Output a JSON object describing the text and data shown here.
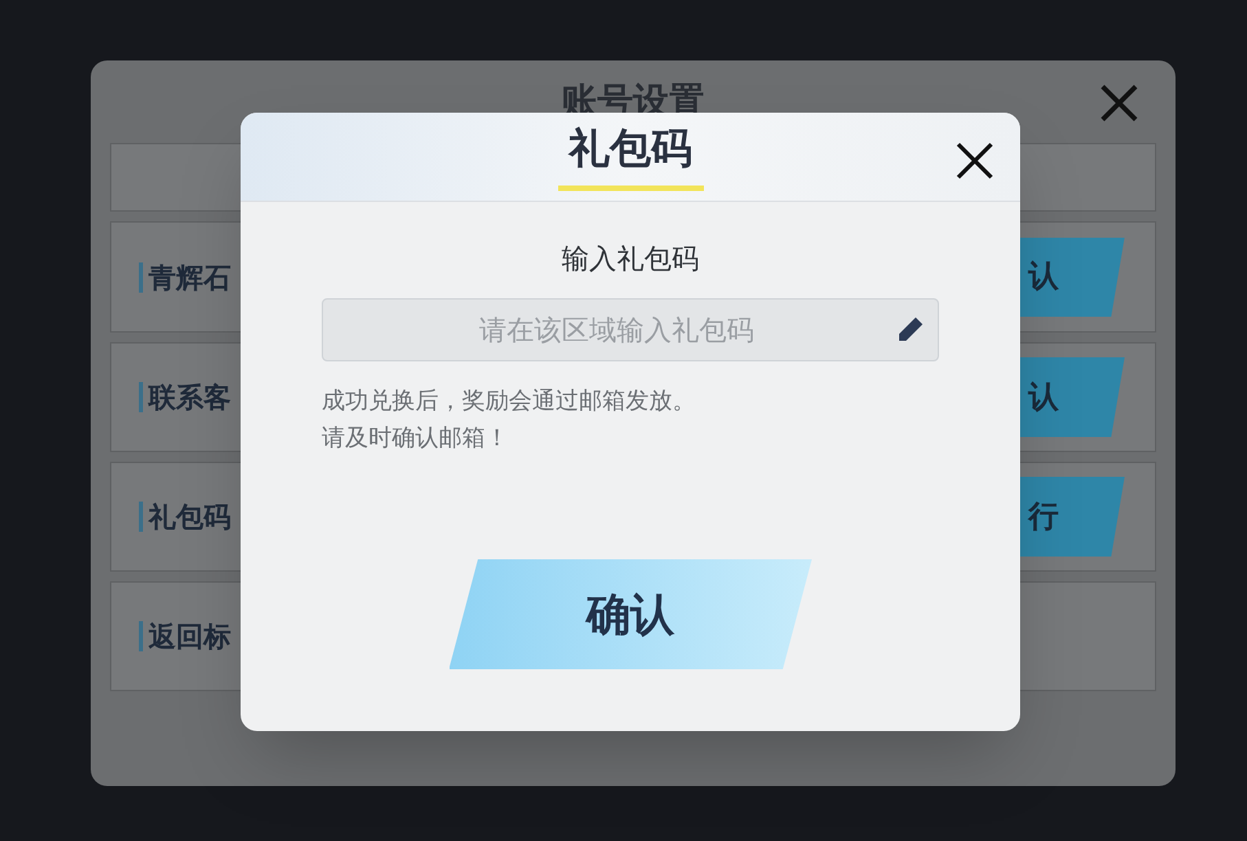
{
  "back_dialog": {
    "title": "账号设置",
    "rows": [
      {
        "label": "",
        "button": ""
      },
      {
        "label": "青辉石",
        "button": "认"
      },
      {
        "label": "联系客",
        "button": "认"
      },
      {
        "label": "礼包码",
        "button": "行"
      },
      {
        "label": "返回标",
        "button": ""
      }
    ]
  },
  "dialog": {
    "title": "礼包码",
    "heading": "输入礼包码",
    "input": {
      "placeholder": "请在该区域输入礼包码"
    },
    "note_lines": [
      "成功兑换后，奖励会通过邮箱发放。",
      "请及时确认邮箱！"
    ],
    "confirm_button": "确认"
  }
}
